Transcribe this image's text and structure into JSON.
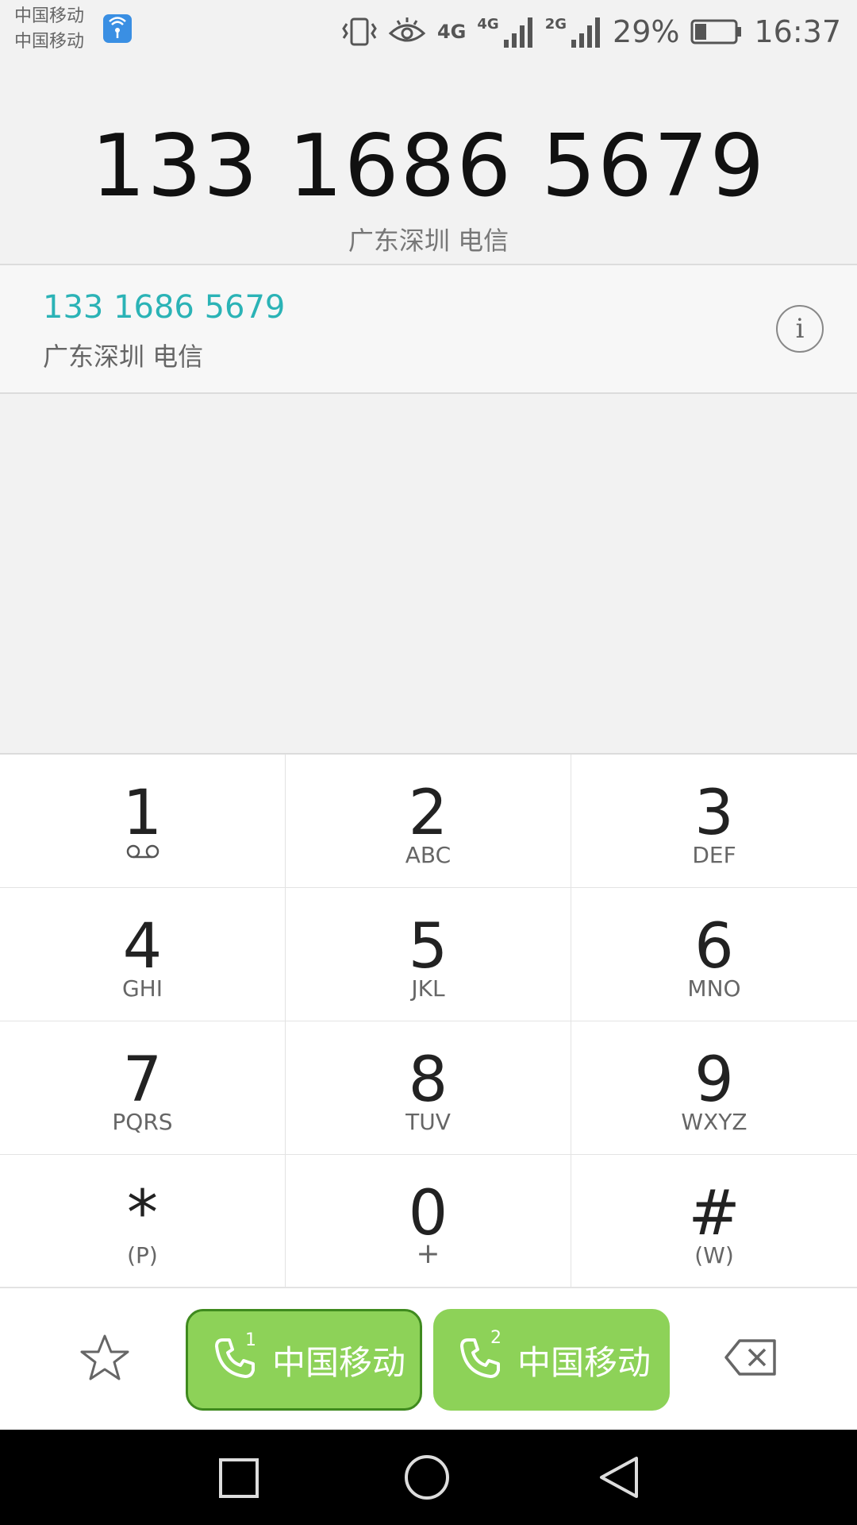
{
  "status_bar": {
    "carrier_1": "中国移动",
    "carrier_2": "中国移动",
    "net_1": "4G",
    "net_2": "4G",
    "net_3": "2G",
    "battery": "29%",
    "time": "16:37"
  },
  "header": {
    "dialed_number": "133 1686 5679",
    "location": "广东深圳 电信"
  },
  "result": {
    "number": "133 1686 5679",
    "location": "广东深圳 电信"
  },
  "keypad": {
    "keys": [
      {
        "digit": "1",
        "letters": ""
      },
      {
        "digit": "2",
        "letters": "ABC"
      },
      {
        "digit": "3",
        "letters": "DEF"
      },
      {
        "digit": "4",
        "letters": "GHI"
      },
      {
        "digit": "5",
        "letters": "JKL"
      },
      {
        "digit": "6",
        "letters": "MNO"
      },
      {
        "digit": "7",
        "letters": "PQRS"
      },
      {
        "digit": "8",
        "letters": "TUV"
      },
      {
        "digit": "9",
        "letters": "WXYZ"
      },
      {
        "digit": "*",
        "letters": "(P)"
      },
      {
        "digit": "0",
        "letters": "+"
      },
      {
        "digit": "#",
        "letters": "(W)"
      }
    ]
  },
  "actions": {
    "call_sim1_index": "1",
    "call_sim1_label": "中国移动",
    "call_sim2_index": "2",
    "call_sim2_label": "中国移动"
  },
  "colors": {
    "accent": "#2bb3b6",
    "call_green": "#8dd258",
    "call_border": "#3f8a1e"
  }
}
